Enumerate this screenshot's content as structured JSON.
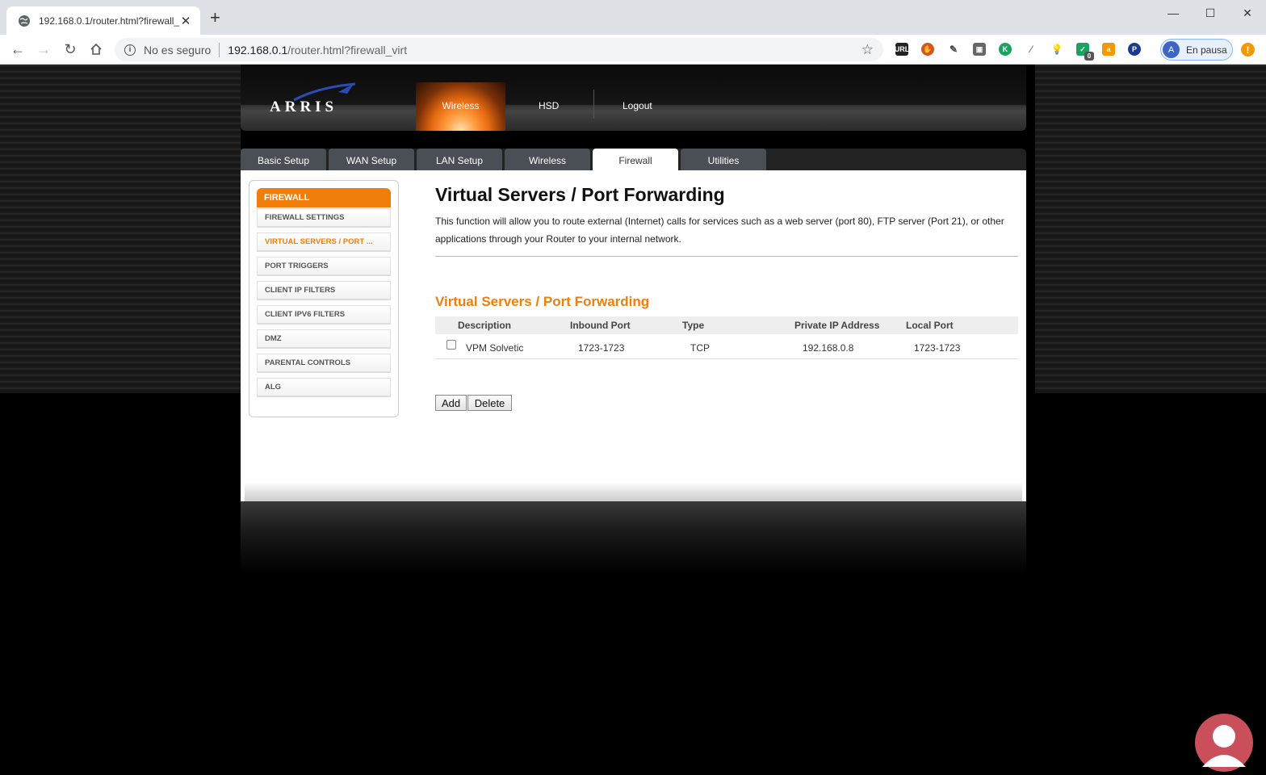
{
  "browser": {
    "tab_title": "192.168.0.1/router.html?firewall_virt",
    "tab_close": "✕",
    "new_tab": "+",
    "security_label": "No es seguro",
    "url_host": "192.168.0.1",
    "url_path": "/router.html?firewall_virt",
    "profile_initial": "A",
    "profile_label": "En pausa",
    "ext_badge": "0",
    "menu_glyph": "!"
  },
  "router": {
    "brand": "ARRIS",
    "top_nav": [
      "Wireless",
      "HSD",
      "Logout"
    ],
    "tabs": [
      "Basic Setup",
      "WAN Setup",
      "LAN Setup",
      "Wireless",
      "Firewall",
      "Utilities"
    ],
    "active_tab": "Firewall",
    "side_menu": {
      "header": "FIREWALL",
      "items": [
        "FIREWALL SETTINGS",
        "VIRTUAL SERVERS / PORT ...",
        "PORT TRIGGERS",
        "CLIENT IP FILTERS",
        "CLIENT IPV6 FILTERS",
        "DMZ",
        "PARENTAL CONTROLS",
        "ALG"
      ]
    },
    "page_title": "Virtual Servers / Port Forwarding",
    "description": "This function will allow you to route external (Internet) calls for services such as a web server (port 80), FTP server (Port 21), or other applications through your Router to your internal network.",
    "section_title": "Virtual Servers / Port Forwarding",
    "table": {
      "headers": [
        "Description",
        "Inbound Port",
        "Type",
        "Private IP Address",
        "Local Port"
      ],
      "rows": [
        {
          "description": "VPM Solvetic",
          "inbound_port": "1723-1723",
          "type": "TCP",
          "private_ip": "192.168.0.8",
          "local_port": "1723-1723"
        }
      ]
    },
    "buttons": {
      "add": "Add",
      "delete": "Delete"
    }
  },
  "colors": {
    "accent": "#f07e0a",
    "tab_bg": "#4a4f55"
  }
}
